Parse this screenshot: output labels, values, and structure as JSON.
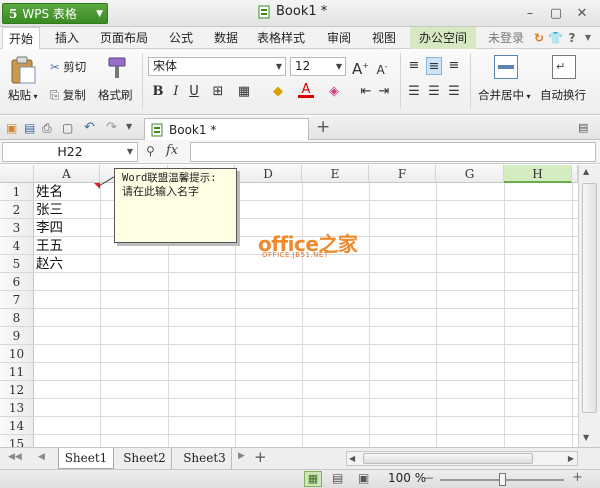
{
  "titlebar": {
    "app_name": "WPS 表格",
    "doc_title": "Book1 *",
    "min": "–",
    "max": "▢",
    "close": "✕"
  },
  "menu": {
    "items": [
      "开始",
      "插入",
      "页面布局",
      "公式",
      "数据",
      "表格样式",
      "审阅",
      "视图",
      "办公空间"
    ],
    "login": "未登录",
    "help": "?"
  },
  "ribbon": {
    "paste": "粘贴",
    "cut": "剪切",
    "copy": "复制",
    "format_painter": "格式刷",
    "font_name": "宋体",
    "font_size": "12",
    "bold": "B",
    "italic": "I",
    "underline": "U",
    "font_grow": "A",
    "font_shrink": "A",
    "merge_center": "合并居中",
    "wrap_text": "自动换行"
  },
  "quickbar": {
    "doc_tab": "Book1 *",
    "add_tab": "+"
  },
  "formula_bar": {
    "name_box": "H22",
    "fx": "fx",
    "formula": ""
  },
  "grid": {
    "columns": [
      "A",
      "B",
      "C",
      "D",
      "E",
      "F",
      "G",
      "H"
    ],
    "selected_column": "H",
    "rows": [
      "1",
      "2",
      "3",
      "4",
      "5",
      "6",
      "7",
      "8",
      "9",
      "10",
      "11",
      "12",
      "13",
      "14",
      "15"
    ],
    "cells": [
      {
        "ref": "A1",
        "value": "姓名"
      },
      {
        "ref": "A2",
        "value": "张三"
      },
      {
        "ref": "A3",
        "value": "李四"
      },
      {
        "ref": "A4",
        "value": "王五"
      },
      {
        "ref": "A5",
        "value": "赵六"
      }
    ]
  },
  "comment": {
    "line1": "Word联盟温馨提示:",
    "line2": "请在此输入名字"
  },
  "watermark": {
    "text": "office之家",
    "sub": "OFFICE.JB51.NET"
  },
  "sheets": {
    "tabs": [
      "Sheet1",
      "Sheet2",
      "Sheet3"
    ],
    "active": "Sheet1",
    "add": "+"
  },
  "status": {
    "zoom": "100 %",
    "zoom_level": 0.5
  },
  "colors": {
    "accent_green": "#3b8a23",
    "selected_header": "#d3ecc0",
    "comment_bg": "#fffde4"
  }
}
